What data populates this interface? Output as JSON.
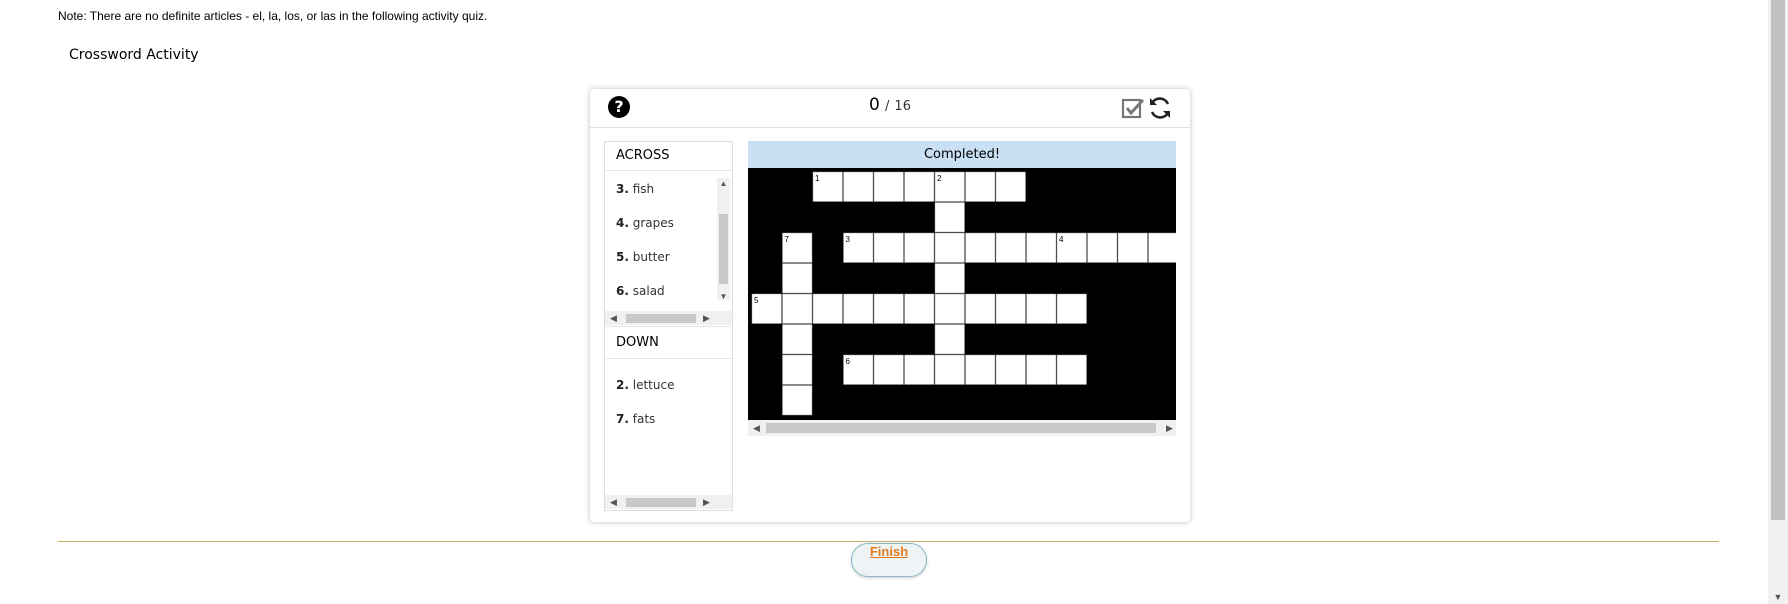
{
  "note": "Note: There are no definite articles - el, la, los, or las in the following activity quiz.",
  "activity_title": "Crossword Activity",
  "score": {
    "current": "0",
    "slash": "/",
    "total": "16"
  },
  "help_label": "?",
  "across": {
    "heading": "ACROSS",
    "items": [
      {
        "num": "3.",
        "text": "fish"
      },
      {
        "num": "4.",
        "text": "grapes"
      },
      {
        "num": "5.",
        "text": "butter"
      },
      {
        "num": "6.",
        "text": "salad"
      }
    ]
  },
  "down": {
    "heading": "DOWN",
    "items": [
      {
        "num": "2.",
        "text": "lettuce"
      },
      {
        "num": "7.",
        "text": "fats"
      }
    ]
  },
  "status": "Completed!",
  "finish_label": "Finish",
  "crossword": {
    "words": [
      {
        "row": 0,
        "col": 2,
        "dir": "across",
        "len": 7,
        "num": "1"
      },
      {
        "row": 0,
        "col": 6,
        "dir": "down",
        "len": 1,
        "num": "2"
      },
      {
        "row": 2,
        "col": 3,
        "dir": "across",
        "len": 11,
        "num": "3"
      },
      {
        "row": 2,
        "col": 10,
        "dir": "across",
        "len": 1,
        "num": "4"
      },
      {
        "row": 4,
        "col": 0,
        "dir": "across",
        "len": 11,
        "num": "5"
      },
      {
        "row": 6,
        "col": 3,
        "dir": "across",
        "len": 8,
        "num": "6"
      },
      {
        "row": 2,
        "col": 1,
        "dir": "down",
        "len": 6,
        "num": "7"
      },
      {
        "row": 0,
        "col": 6,
        "dir": "down",
        "len": 7,
        "num": ""
      }
    ]
  }
}
